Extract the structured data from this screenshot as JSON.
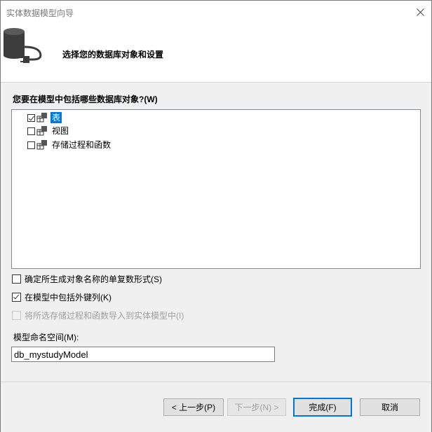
{
  "window": {
    "title": "实体数据模型向导"
  },
  "header": {
    "text": "选择您的数据库对象和设置"
  },
  "objects": {
    "label": "您要在模型中包括哪些数据库对象?(W)",
    "items": [
      {
        "label": "表",
        "checked": true,
        "selected": true
      },
      {
        "label": "视图",
        "checked": false,
        "selected": false
      },
      {
        "label": "存储过程和函数",
        "checked": false,
        "selected": false
      }
    ]
  },
  "options": {
    "pluralize": {
      "label": "确定所生成对象名称的单复数形式(S)",
      "checked": false,
      "enabled": true
    },
    "foreign_keys": {
      "label": "在模型中包括外键列(K)",
      "checked": true,
      "enabled": true
    },
    "import_procs": {
      "label": "将所选存储过程和函数导入到实体模型中(I)",
      "checked": false,
      "enabled": false
    }
  },
  "namespace": {
    "label": "模型命名空间(M):",
    "value": "db_mystudyModel"
  },
  "buttons": {
    "back": "< 上一步(P)",
    "next": "下一步(N) >",
    "finish": "完成(F)",
    "cancel": "取消"
  }
}
